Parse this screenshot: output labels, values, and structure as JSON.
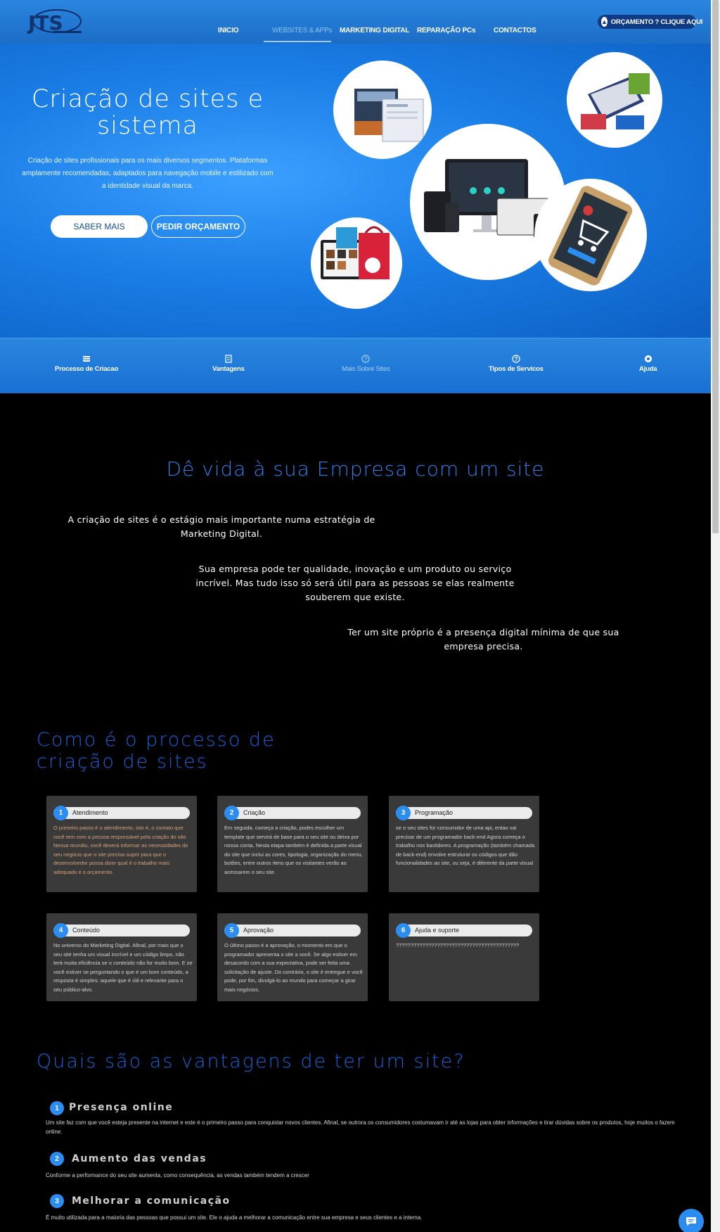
{
  "header": {
    "logo_text": "JTS",
    "nav": [
      "INICIO",
      "WEBSITES & APPs",
      "MARKETING DIGITAL",
      "REPARAÇÃO PCs",
      "CONTACTOS"
    ],
    "quote_button": "ORÇAMENTO ? CLIQUE AQUI"
  },
  "hero": {
    "title": "Criação de sites e sistema",
    "text": "Criação de sites profissionais para os mais diversos segmentos. Plataformas amplamente recomendadas, adaptados para navegação mobile e estilizado com a identidade visual da marca.",
    "btn_primary": "SABER MAIS",
    "btn_secondary": "PEDIR ORÇAMENTO",
    "images": [
      "web design screens",
      "laptop with website",
      "responsive devices",
      "online shopping bag",
      "mobile shopping cart"
    ]
  },
  "subnav": [
    {
      "label": "Processo de Criacao",
      "icon": "list-icon"
    },
    {
      "label": "Vantagens",
      "icon": "document-icon"
    },
    {
      "label": "Mais Sobre Sites",
      "icon": "help-circle-icon"
    },
    {
      "label": "Tipos de Servicos",
      "icon": "help-circle-icon"
    },
    {
      "label": "Ajuda",
      "icon": "camera-icon"
    }
  ],
  "intro": {
    "title": "Dê vida à sua Empresa com um site",
    "p1": "A criação de sites é o estágio mais importante numa estratégia de Marketing Digital.",
    "p2": "Sua empresa pode ter qualidade, inovação e um produto ou serviço incrível. Mas tudo isso só será útil para as pessoas se elas realmente souberem que existe.",
    "p3": "Ter um site próprio é a presença digital mínima de que sua empresa precisa."
  },
  "process": {
    "title": "Como é o processo de criação de sites",
    "steps": [
      {
        "num": "1",
        "title": "Atendimento",
        "text": "O primeiro passo é o atendimento, isto é, o contato que você tem com a pessoa responsável pela criação do site. Nessa reunião, você deverá informar as necessidades do seu negócio que o site precisa suprir para que o desenvolvedor possa dizer qual é o trabalho mais adequado e o orçamento."
      },
      {
        "num": "2",
        "title": "Criação",
        "text": "Em seguida, começa a criação, podes escolher um template que servirá de base para o seu site ou deixa por nossa conta, Nesta etapa também é definida a parte visual do site que inclui as cores, tipologia, organização do menu, botões, entre outros itens que os visitantes verão ao acessarem o seu site."
      },
      {
        "num": "3",
        "title": "Programação",
        "text": "se o seu sites for consumidor de uma api, entao vai precisar de um programador back-end Agora começa o trabalho nos bastidores. A programação (também chamada de back-end) envolve estruturar os códigos que dão funcionalidades ao site, ou seja, é diferente da parte visual"
      },
      {
        "num": "4",
        "title": "Conteúdo",
        "text": "No universo do Marketing Digital. Afinal, por mais que o seu site tenha um visual incrível e um código limpo, não terá muita eficiência se o conteúdo não for muito bom. E se você estiver se perguntando o que é um bom conteúdo, a resposta é simples: aquele que é útil e relevante para o seu público-alvo."
      },
      {
        "num": "5",
        "title": "Aprovação",
        "text": "O último passo é a aprovação, o momento em que o programador apresenta o site a você. Se algo estiver em desacordo com a sua expectativa, pode ser feita uma solicitação de ajuste. Do contrário, o site é entregue e você pode, por fim, divulgá-lo ao mundo para começar a girar mais negócios."
      },
      {
        "num": "6",
        "title": "Ajuda e suporte",
        "text": "??????????????????????????????????????????"
      }
    ]
  },
  "advantages": {
    "title": "Quais são as vantagens de ter um site?",
    "items": [
      {
        "num": "1",
        "title": "Presença online",
        "text": "Um site faz com que você esteja presente na internet e este é o primeiro passo para conquistar novos clientes. Afinal, se outrora os consumidores costumavam ir até as lojas para obter informações e tirar dúvidas sobre os produtos, hoje muitos o fazem online."
      },
      {
        "num": "2",
        "title": "Aumento das vendas",
        "text": "Conforme a performance do seu site aumenta, como consequência, as vendas também tendem a crescer"
      },
      {
        "num": "3",
        "title": "Melhorar a comunicação",
        "text": "É muito utilizada para a maioria das pessoas que possui um site. Ele o ajuda a melhorar a comunicação entre sua empresa e seus clientes e a interna."
      }
    ]
  },
  "colors": {
    "accent": "#2b8df0",
    "header": "#1c6dc6",
    "title_blue": "#1a62d8"
  }
}
